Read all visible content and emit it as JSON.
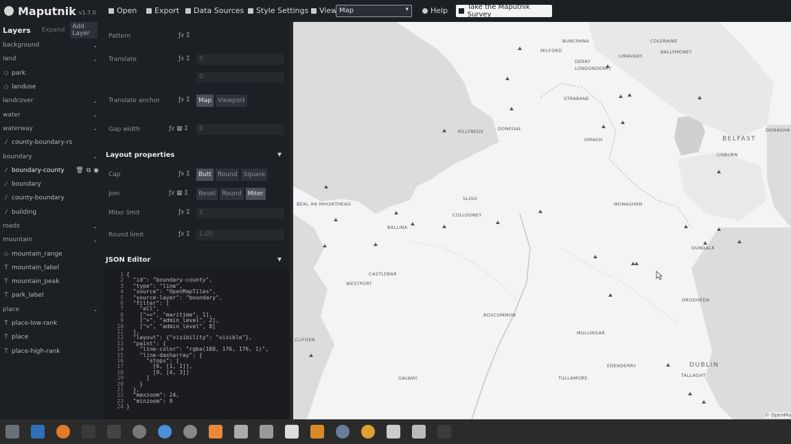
{
  "app": {
    "name": "Maputnik",
    "version": "v1.7.0"
  },
  "toolbar": {
    "open": "Open",
    "export": "Export",
    "data_sources": "Data Sources",
    "style_settings": "Style Settings",
    "view_label": "View",
    "view_value": "Map",
    "help": "Help",
    "survey": "Take the Maputnik Survey"
  },
  "layers": {
    "title": "Layers",
    "expand": "Expand",
    "add": "Add Layer",
    "items": [
      {
        "label": "background",
        "kind": "group"
      },
      {
        "label": "land",
        "kind": "group"
      },
      {
        "label": "park",
        "kind": "fill"
      },
      {
        "label": "landuse",
        "kind": "fill"
      },
      {
        "label": "landcover",
        "kind": "group"
      },
      {
        "label": "water",
        "kind": "group"
      },
      {
        "label": "waterway",
        "kind": "group"
      },
      {
        "label": "county-boundary-rs",
        "kind": "line"
      },
      {
        "label": "boundary",
        "kind": "group"
      },
      {
        "label": "boundary-county",
        "kind": "line",
        "selected": true
      },
      {
        "label": "boundary",
        "kind": "line"
      },
      {
        "label": "county-boundary",
        "kind": "line"
      },
      {
        "label": "building",
        "kind": "line"
      },
      {
        "label": "roads",
        "kind": "group"
      },
      {
        "label": "mountain",
        "kind": "group"
      },
      {
        "label": "mountain_range",
        "kind": "fill"
      },
      {
        "label": "mountain_label",
        "kind": "symbol"
      },
      {
        "label": "mountain_peak",
        "kind": "symbol"
      },
      {
        "label": "park_label",
        "kind": "symbol"
      },
      {
        "label": "place",
        "kind": "group"
      },
      {
        "label": "place-low-rank",
        "kind": "symbol"
      },
      {
        "label": "place",
        "kind": "symbol"
      },
      {
        "label": "place-high-rank",
        "kind": "symbol"
      }
    ]
  },
  "paint": {
    "pattern": "Pattern",
    "translate": "Translate",
    "translate_x": "0",
    "translate_y": "0",
    "translate_anchor": "Translate anchor",
    "anchor_options": [
      "Map",
      "Viewport"
    ],
    "gap_width": "Gap width",
    "gap_width_value": "0"
  },
  "layout": {
    "title": "Layout properties",
    "cap": "Cap",
    "cap_options": [
      "Butt",
      "Round",
      "Square"
    ],
    "join": "Join",
    "join_options": [
      "Bevel",
      "Round",
      "Miter"
    ],
    "miter_limit": "Miter limit",
    "miter_value": "2",
    "round_limit": "Round limit",
    "round_value": "1.05"
  },
  "json_editor": {
    "title": "JSON Editor",
    "lines": [
      "{",
      "  \"id\": \"boundary-county\",",
      "  \"type\": \"line\",",
      "  \"source\": \"OpenMapTiles\",",
      "  \"source-layer\": \"boundary\",",
      "  \"filter\": [",
      "    \"all\",",
      "    [\"==\", \"maritime\", 1],",
      "    [\">\", \"admin_level\", 2],",
      "    [\"<\", \"admin_level\", 8]",
      "  ],",
      "  \"layout\": {\"visibility\": \"visible\"},",
      "  \"paint\": {",
      "    \"line-color\": \"rgba(180, 176, 176, 1)\",",
      "    \"line-dasharray\": {",
      "      \"stops\": [",
      "        [6, [1, 1]],",
      "        [9, [4, 3]]",
      "      ]",
      "    }",
      "  },",
      "  \"maxzoom\": 24,",
      "  \"minzoom\": 9",
      "}"
    ]
  },
  "map": {
    "places": [
      "BUNCRANA",
      "COLERAINE",
      "MILFORD",
      "LIMAVADY",
      "BALLYMONEY",
      "DERRY",
      "LONDONDERRY",
      "STRABANE",
      "KILLYBEGS",
      "DONEGAL",
      "OMAGH",
      "BELFAST",
      "DONAGHA",
      "LISBURN",
      "BÉAL AN MHUIRTHEAD",
      "SLIGO",
      "COLLOONEY",
      "BALLINA",
      "MONAGHAN",
      "DUNDALK",
      "CASTLEBAR",
      "WESTPORT",
      "ROSCOMMON",
      "DROGHEDA",
      "MULLINGAR",
      "CLIFDEN",
      "EDENDERRY",
      "DUBLIN",
      "TULLAMORE",
      "TALLAGHT",
      "GALWAY"
    ],
    "attribution": "© OpenMa"
  }
}
